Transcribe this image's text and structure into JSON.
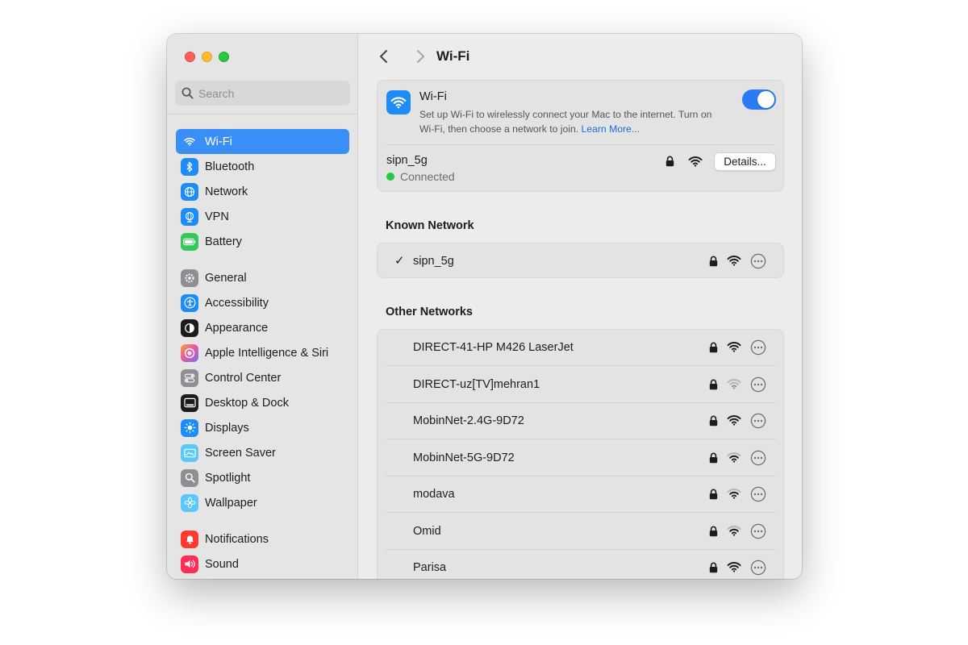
{
  "window": {
    "title": "Wi-Fi"
  },
  "sidebar": {
    "search_placeholder": "Search",
    "items": [
      {
        "label": "Wi-Fi",
        "icon": "wifi-icon",
        "color": "#1e8cf7",
        "active": true
      },
      {
        "label": "Bluetooth",
        "icon": "bluetooth-icon",
        "color": "#1e8cf7"
      },
      {
        "label": "Network",
        "icon": "globe-icon",
        "color": "#1e8cf7"
      },
      {
        "label": "VPN",
        "icon": "vpn-globe-icon",
        "color": "#1e8cf7"
      },
      {
        "label": "Battery",
        "icon": "battery-icon",
        "color": "#34c759"
      },
      {
        "label": "General",
        "icon": "gear-icon",
        "color": "#8e8e93"
      },
      {
        "label": "Accessibility",
        "icon": "accessibility-icon",
        "color": "#1e8cf7"
      },
      {
        "label": "Appearance",
        "icon": "appearance-icon",
        "color": "#1c1c1e"
      },
      {
        "label": "Apple Intelligence & Siri",
        "icon": "siri-icon",
        "color": "#d06bd6"
      },
      {
        "label": "Control Center",
        "icon": "control-center-icon",
        "color": "#8e8e93"
      },
      {
        "label": "Desktop & Dock",
        "icon": "dock-icon",
        "color": "#1c1c1e"
      },
      {
        "label": "Displays",
        "icon": "sun-icon",
        "color": "#1e8cf7"
      },
      {
        "label": "Screen Saver",
        "icon": "screen-saver-icon",
        "color": "#5ac8fa"
      },
      {
        "label": "Spotlight",
        "icon": "magnifier-icon",
        "color": "#8e8e93"
      },
      {
        "label": "Wallpaper",
        "icon": "flower-icon",
        "color": "#5ac8fa"
      },
      {
        "label": "Notifications",
        "icon": "bell-icon",
        "color": "#ff3b30"
      },
      {
        "label": "Sound",
        "icon": "speaker-icon",
        "color": "#ff2d55"
      }
    ]
  },
  "toolbar": {
    "back": "chevron-left-icon",
    "forward": "chevron-right-icon"
  },
  "wifi_card": {
    "title": "Wi-Fi",
    "description": "Set up Wi-Fi to wirelessly connect your Mac to the internet. Turn on Wi-Fi, then choose a network to join.",
    "learn_more": "Learn More...",
    "enabled": true,
    "current_network": "sipn_5g",
    "status": "Connected",
    "details_label": "Details..."
  },
  "known": {
    "title": "Known Network",
    "networks": [
      {
        "name": "sipn_5g",
        "checked": true,
        "signal": "full"
      }
    ]
  },
  "other": {
    "title": "Other Networks",
    "networks": [
      {
        "name": "DIRECT-41-HP M426 LaserJet",
        "signal": "full"
      },
      {
        "name": "DIRECT-uz[TV]mehran1",
        "signal": "weak"
      },
      {
        "name": "MobinNet-2.4G-9D72",
        "signal": "full"
      },
      {
        "name": "MobinNet-5G-9D72",
        "signal": "medium"
      },
      {
        "name": "modava",
        "signal": "medium"
      },
      {
        "name": "Omid",
        "signal": "medium"
      },
      {
        "name": "Parisa",
        "signal": "full"
      }
    ]
  },
  "colors": {
    "accent": "#3a8ff6",
    "toggle_on": "#2a7cf4",
    "connected": "#28c840",
    "link": "#1a6fe0"
  }
}
